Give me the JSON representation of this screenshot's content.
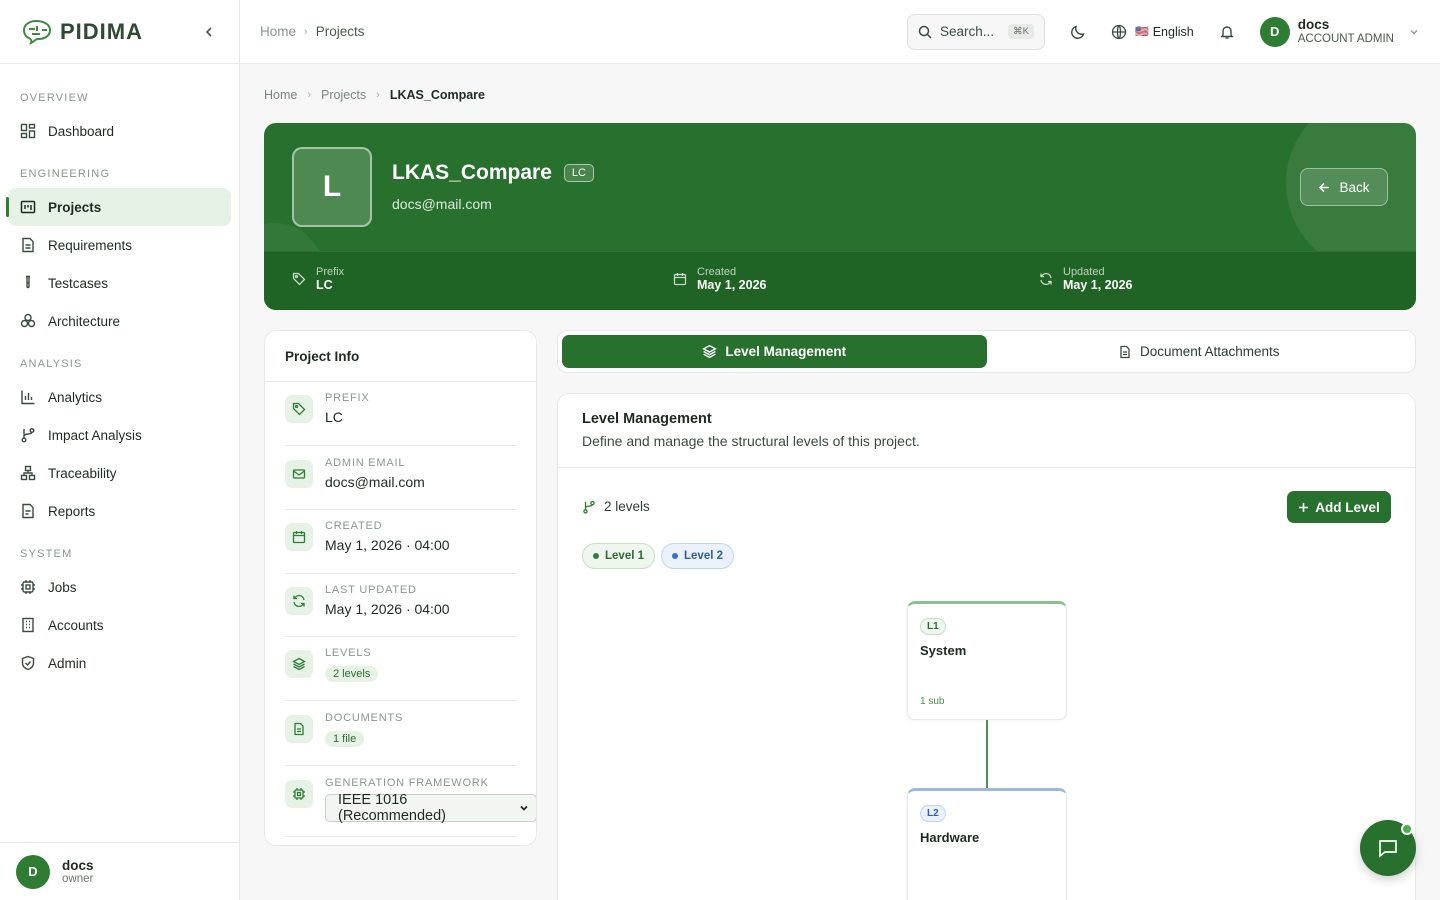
{
  "app": {
    "name": "PIDIMA"
  },
  "sidebar": {
    "sections": [
      {
        "title": "OVERVIEW",
        "items": [
          {
            "label": "Dashboard",
            "icon": "dashboard-icon"
          }
        ]
      },
      {
        "title": "ENGINEERING",
        "items": [
          {
            "label": "Projects",
            "icon": "projects-icon",
            "active": true
          },
          {
            "label": "Requirements",
            "icon": "requirements-icon"
          },
          {
            "label": "Testcases",
            "icon": "testcases-icon"
          },
          {
            "label": "Architecture",
            "icon": "architecture-icon"
          }
        ]
      },
      {
        "title": "ANALYSIS",
        "items": [
          {
            "label": "Analytics",
            "icon": "analytics-icon"
          },
          {
            "label": "Impact Analysis",
            "icon": "impact-icon"
          },
          {
            "label": "Traceability",
            "icon": "traceability-icon"
          },
          {
            "label": "Reports",
            "icon": "reports-icon"
          }
        ]
      },
      {
        "title": "SYSTEM",
        "items": [
          {
            "label": "Jobs",
            "icon": "jobs-icon"
          },
          {
            "label": "Accounts",
            "icon": "accounts-icon"
          },
          {
            "label": "Admin",
            "icon": "admin-icon"
          }
        ]
      }
    ],
    "user": {
      "initial": "D",
      "name": "docs",
      "role": "owner"
    }
  },
  "topbar": {
    "breadcrumb": [
      "Home",
      "Projects"
    ],
    "search": {
      "placeholder": "Search...",
      "shortcut": "⌘K"
    },
    "language": {
      "flag": "🇺🇸",
      "label": "English"
    },
    "user": {
      "initial": "D",
      "name": "docs",
      "role": "ACCOUNT ADMIN"
    }
  },
  "page": {
    "breadcrumb": [
      "Home",
      "Projects",
      "LKAS_Compare"
    ],
    "project": {
      "initial": "L",
      "name": "LKAS_Compare",
      "prefix": "LC",
      "email": "docs@mail.com",
      "back_label": "Back",
      "meta": [
        {
          "label": "Prefix",
          "value": "LC",
          "icon": "tag-icon"
        },
        {
          "label": "Created",
          "value": "May 1, 2026",
          "icon": "calendar-icon"
        },
        {
          "label": "Updated",
          "value": "May 1, 2026",
          "icon": "refresh-icon"
        }
      ]
    },
    "info": {
      "title": "Project Info",
      "prefix_label": "PREFIX",
      "prefix_value": "LC",
      "email_label": "ADMIN EMAIL",
      "email_value": "docs@mail.com",
      "created_label": "CREATED",
      "created_value": "May 1, 2026 · 04:00",
      "updated_label": "LAST UPDATED",
      "updated_value": "May 1, 2026 · 04:00",
      "levels_label": "LEVELS",
      "levels_value": "2 levels",
      "documents_label": "DOCUMENTS",
      "documents_value": "1 file",
      "framework_label": "GENERATION FRAMEWORK",
      "framework_value": "IEEE 1016 (Recommended)"
    },
    "tabs": [
      {
        "label": "Level Management",
        "active": true
      },
      {
        "label": "Document Attachments"
      }
    ],
    "level_management": {
      "title": "Level Management",
      "subtitle": "Define and manage the structural levels of this project.",
      "count": "2 levels",
      "add_label": "Add Level",
      "pills": [
        "Level 1",
        "Level 2"
      ],
      "nodes": [
        {
          "badge": "L1",
          "title": "System",
          "sub": "1 sub"
        },
        {
          "badge": "L2",
          "title": "Hardware"
        }
      ]
    }
  },
  "colors": {
    "brand": "#28702d",
    "level1": "#2e7d32",
    "level2": "#3b6fc4"
  }
}
